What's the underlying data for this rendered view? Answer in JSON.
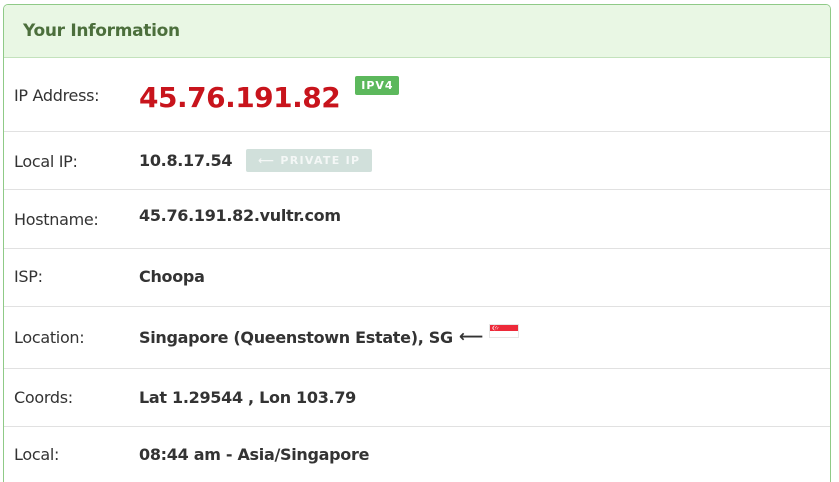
{
  "panel": {
    "title": "Your Information"
  },
  "rows": {
    "ip": {
      "label": "IP Address:",
      "value": "45.76.191.82",
      "badge": "IPV4"
    },
    "local_ip": {
      "label": "Local IP:",
      "value": "10.8.17.54",
      "badge": "⟵ PRIVATE IP"
    },
    "hostname": {
      "label": "Hostname:",
      "value": "45.76.191.82.vultr.com"
    },
    "isp": {
      "label": "ISP:",
      "value": "Choopa"
    },
    "location": {
      "label": "Location:",
      "value": "Singapore (Queenstown Estate), SG",
      "arrow": "⟵",
      "flag_icon": "singapore-flag-icon"
    },
    "coords": {
      "label": "Coords:",
      "value": "Lat 1.29544 , Lon 103.79"
    },
    "local": {
      "label": "Local:",
      "value": "08:44 am - Asia/Singapore"
    }
  },
  "colors": {
    "header_bg": "#e9f7e4",
    "header_text": "#4c6f3c",
    "ip_red": "#c8141c",
    "badge_green": "#5cb85c",
    "badge_private": "#d1e0db"
  }
}
